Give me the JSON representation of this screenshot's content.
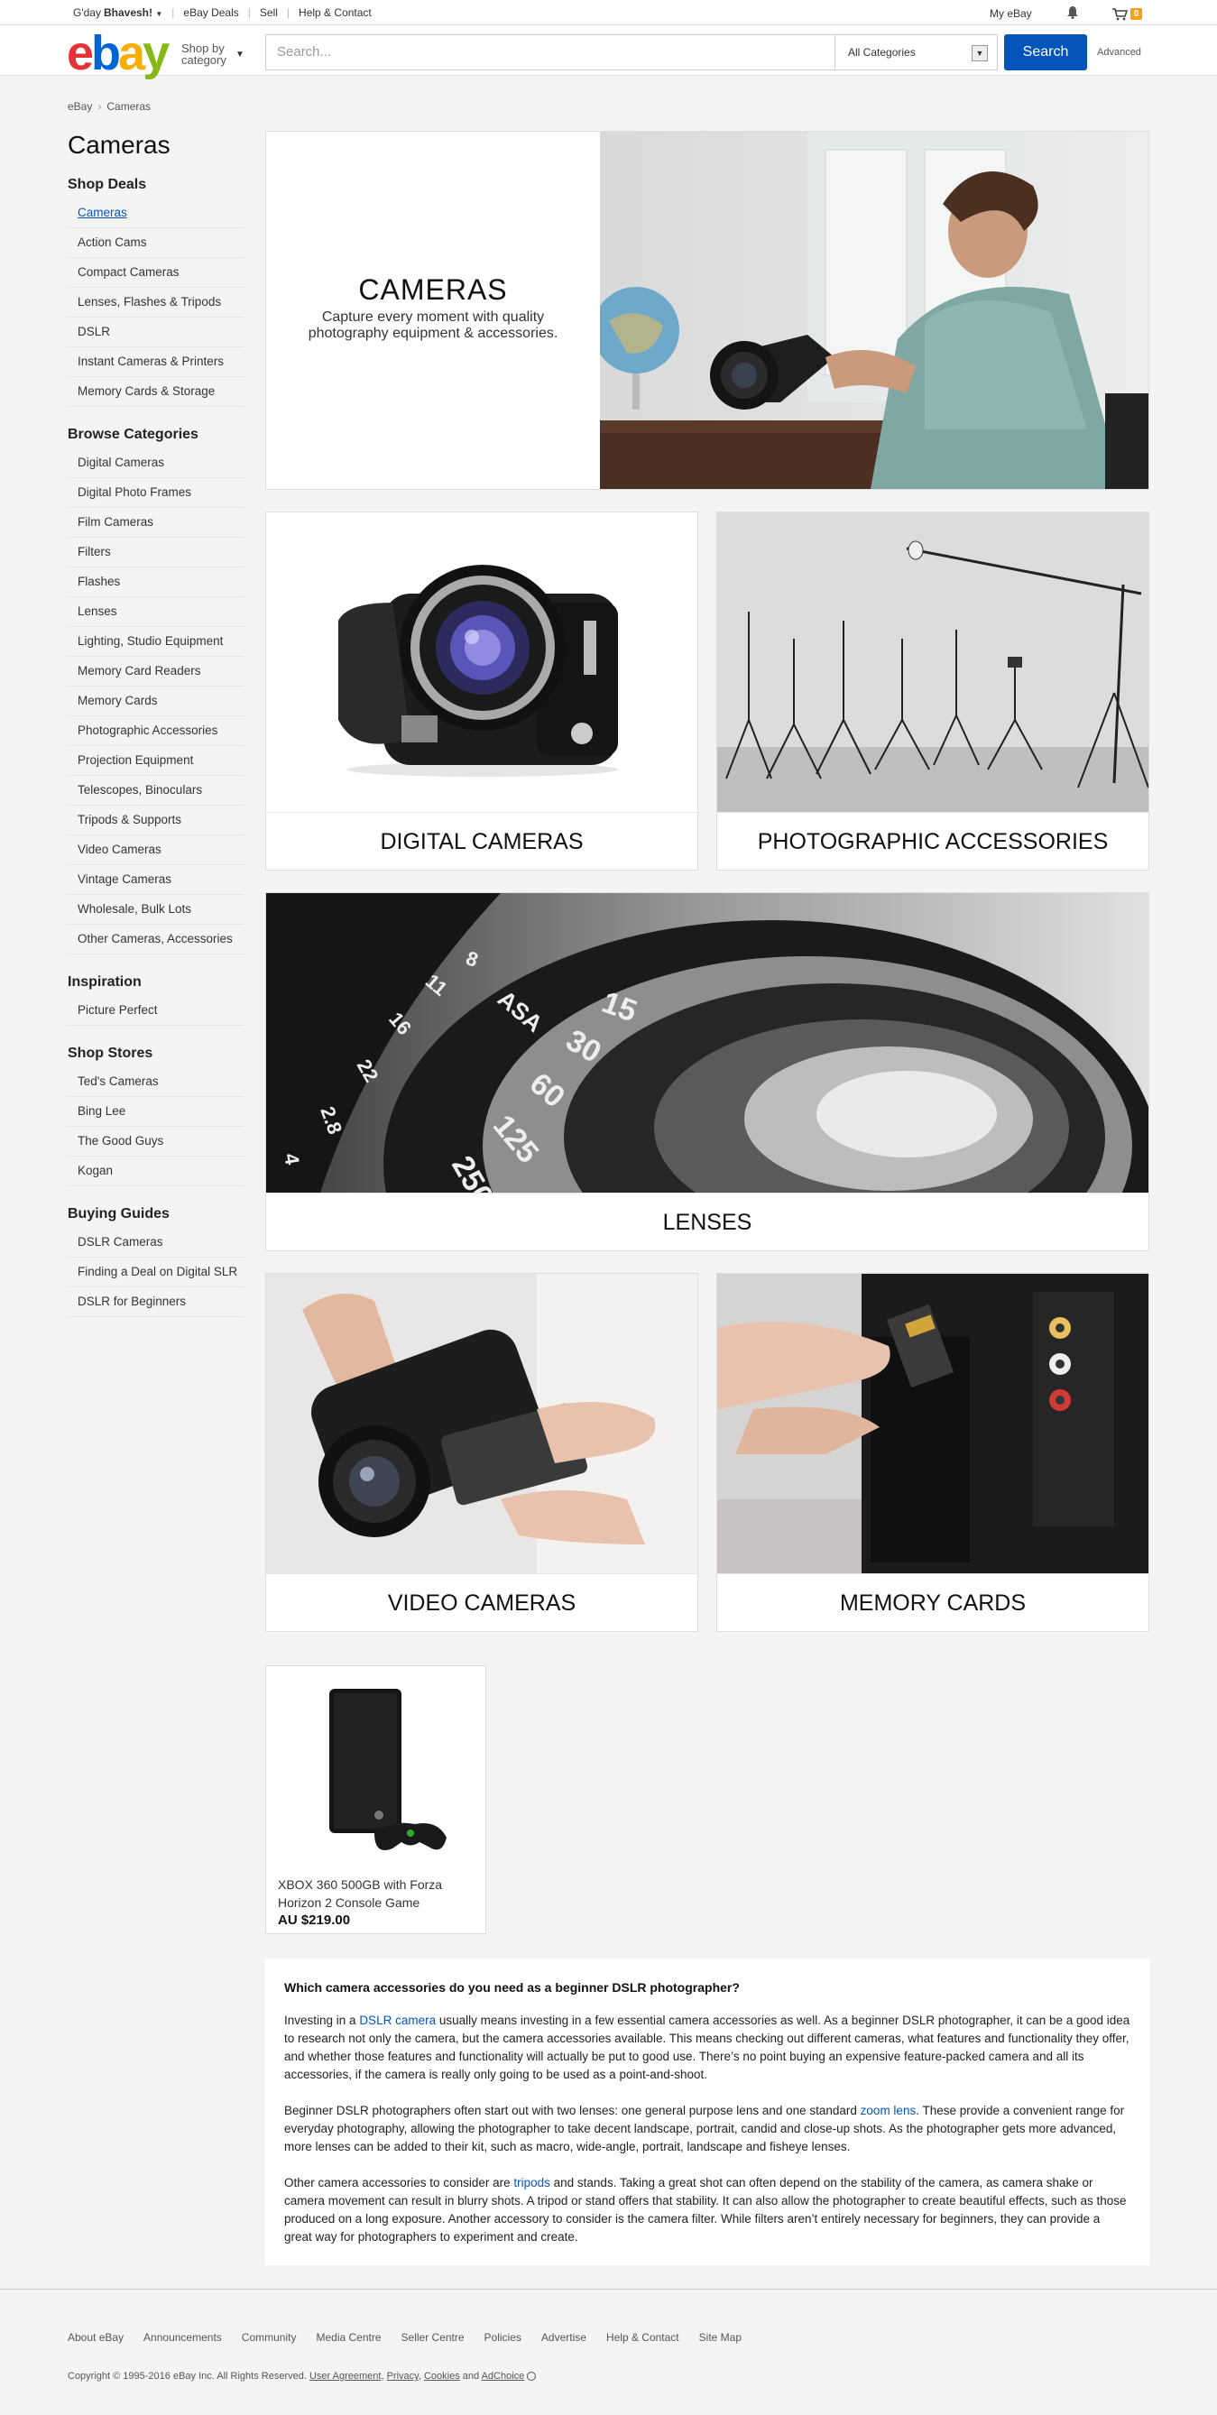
{
  "topbar": {
    "greeting_prefix": "G'day",
    "user_name": "Bhavesh!",
    "deals": "eBay Deals",
    "sell": "Sell",
    "help": "Help & Contact",
    "my_ebay": "My eBay",
    "cart_count": "0"
  },
  "header": {
    "logo_e": "e",
    "logo_b": "b",
    "logo_a": "a",
    "logo_y": "y",
    "shop_by_1": "Shop by",
    "shop_by_2": "category",
    "search_placeholder": "Search...",
    "category_select": "All Categories",
    "search_button": "Search",
    "advanced": "Advanced"
  },
  "breadcrumb": {
    "home": "eBay",
    "current": "Cameras"
  },
  "page_title": "Cameras",
  "sidebar": {
    "shop_deals": {
      "title": "Shop Deals",
      "items": [
        "Cameras",
        "Action Cams",
        "Compact Cameras",
        "Lenses, Flashes & Tripods",
        "DSLR",
        "Instant Cameras & Printers",
        "Memory Cards & Storage"
      ]
    },
    "browse": {
      "title": "Browse Categories",
      "items": [
        "Digital Cameras",
        "Digital Photo Frames",
        "Film Cameras",
        "Filters",
        "Flashes",
        "Lenses",
        "Lighting, Studio Equipment",
        "Memory Card Readers",
        "Memory Cards",
        "Photographic Accessories",
        "Projection Equipment",
        "Telescopes, Binoculars",
        "Tripods & Supports",
        "Video Cameras",
        "Vintage Cameras",
        "Wholesale, Bulk Lots",
        "Other Cameras, Accessories"
      ]
    },
    "inspiration": {
      "title": "Inspiration",
      "items": [
        "Picture Perfect"
      ]
    },
    "stores": {
      "title": "Shop Stores",
      "items": [
        "Ted's Cameras",
        "Bing Lee",
        "The Good Guys",
        "Kogan"
      ]
    },
    "guides": {
      "title": "Buying Guides",
      "items": [
        "DSLR Cameras",
        "Finding a Deal on Digital SLR",
        "DSLR for Beginners"
      ]
    }
  },
  "hero": {
    "title": "CAMERAS",
    "subtitle": "Capture every moment with quality photography equipment & accessories."
  },
  "tiles": {
    "digital": "DIGITAL CAMERAS",
    "accessories": "PHOTOGRAPHIC ACCESSORIES",
    "lenses": "LENSES",
    "video": "VIDEO CAMERAS",
    "memory": "MEMORY CARDS"
  },
  "lens_markings": [
    "ASA",
    "15",
    "30",
    "60",
    "125",
    "250",
    "8",
    "11",
    "16",
    "22",
    "2.8",
    "4"
  ],
  "product": {
    "title": "XBOX 360 500GB with Forza Horizon 2 Console Game",
    "price": "AU $219.00"
  },
  "article": {
    "heading": "Which camera accessories do you need as a beginner DSLR photographer?",
    "p1_pre": "Investing in a ",
    "p1_link": "DSLR camera",
    "p1_post": " usually means investing in a few essential camera accessories as well. As a beginner DSLR photographer, it can be a good idea to research not only the camera, but the camera accessories available. This means checking out different cameras, what features and functionality they offer, and whether those features and functionality will actually be put to good use. There’s no point buying an expensive feature-packed camera and all its accessories, if the camera is really only going to be used as a point-and-shoot.",
    "p2_pre": "Beginner DSLR photographers often start out with two lenses: one general purpose lens and one standard ",
    "p2_link": "zoom lens",
    "p2_post": ". These provide a convenient range for everyday photography, allowing the photographer to take decent landscape, portrait, candid and close-up shots. As the photographer gets more advanced, more lenses can be added to their kit, such as macro, wide-angle, portrait, landscape and fisheye lenses.",
    "p3_pre": "Other camera accessories to consider are ",
    "p3_link": "tripods",
    "p3_post": " and stands. Taking a great shot can often depend on the stability of the camera, as camera shake or camera movement can result in blurry shots. A tripod or stand offers that stability. It can also allow the photographer to create beautiful effects, such as those produced on a long exposure. Another accessory to consider is the camera filter. While filters aren’t entirely necessary for beginners, they can provide a great way for photographers to experiment and create."
  },
  "footer": {
    "links": [
      "About eBay",
      "Announcements",
      "Community",
      "Media Centre",
      "Seller Centre",
      "Policies",
      "Advertise",
      "Help & Contact",
      "Site Map"
    ],
    "copyright_text": "Copyright © 1995-2016 eBay Inc. All Rights Reserved.",
    "user_agreement": "User Agreement",
    "privacy": "Privacy",
    "cookies": "Cookies",
    "and": "and",
    "adchoice": "AdChoice"
  },
  "colors": {
    "brand_blue": "#0654ba",
    "ebay_red": "#e53238",
    "ebay_blue": "#0064d2",
    "ebay_yellow": "#f5af02",
    "ebay_green": "#86b817",
    "cart_badge": "#f7a11a"
  }
}
